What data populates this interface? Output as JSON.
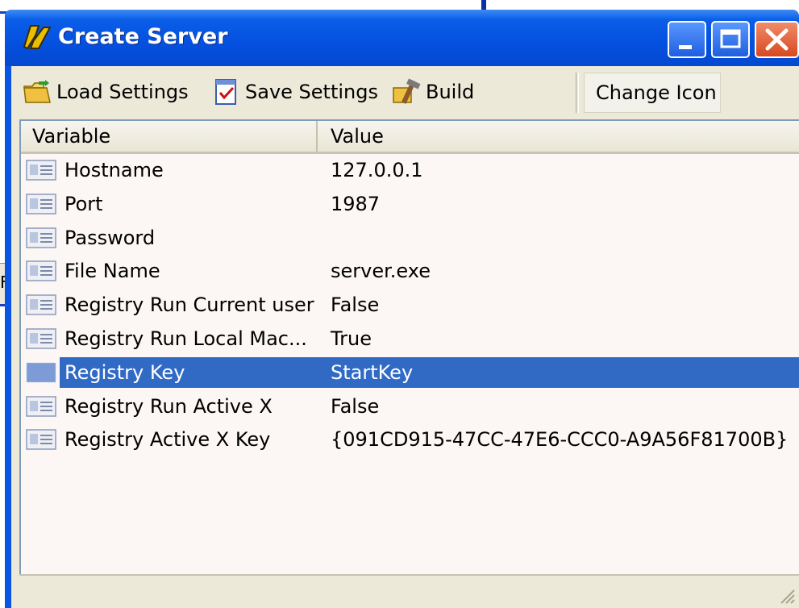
{
  "window": {
    "title": "Create Server",
    "controls": {
      "minimize": "minimize",
      "maximize": "maximize",
      "close": "close"
    }
  },
  "background": {
    "fragment_text": "F"
  },
  "toolbar": {
    "load_label": "Load Settings",
    "save_label": "Save Settings",
    "build_label": "Build",
    "change_icon_label": "Change Icon"
  },
  "list": {
    "columns": [
      "Variable",
      "Value"
    ],
    "rows": [
      {
        "name": "Hostname",
        "value": "127.0.0.1",
        "selected": false
      },
      {
        "name": "Port",
        "value": "1987",
        "selected": false
      },
      {
        "name": "Password",
        "value": "",
        "selected": false
      },
      {
        "name": "File Name",
        "value": "server.exe",
        "selected": false
      },
      {
        "name": "Registry Run Current user",
        "value": "False",
        "selected": false
      },
      {
        "name": "Registry Run Local Mac...",
        "value": "True",
        "selected": false
      },
      {
        "name": "Registry Key",
        "value": "StartKey",
        "selected": true
      },
      {
        "name": "Registry Run Active X",
        "value": "False",
        "selected": false
      },
      {
        "name": "Registry Active X Key",
        "value": "{091CD915-47CC-47E6-CCC0-A9A56F81700B}",
        "selected": false
      }
    ]
  },
  "colors": {
    "titlebar": "#0550df",
    "selection": "#316ac5",
    "list_bg": "#fcf7f4",
    "face": "#ece9d8"
  }
}
